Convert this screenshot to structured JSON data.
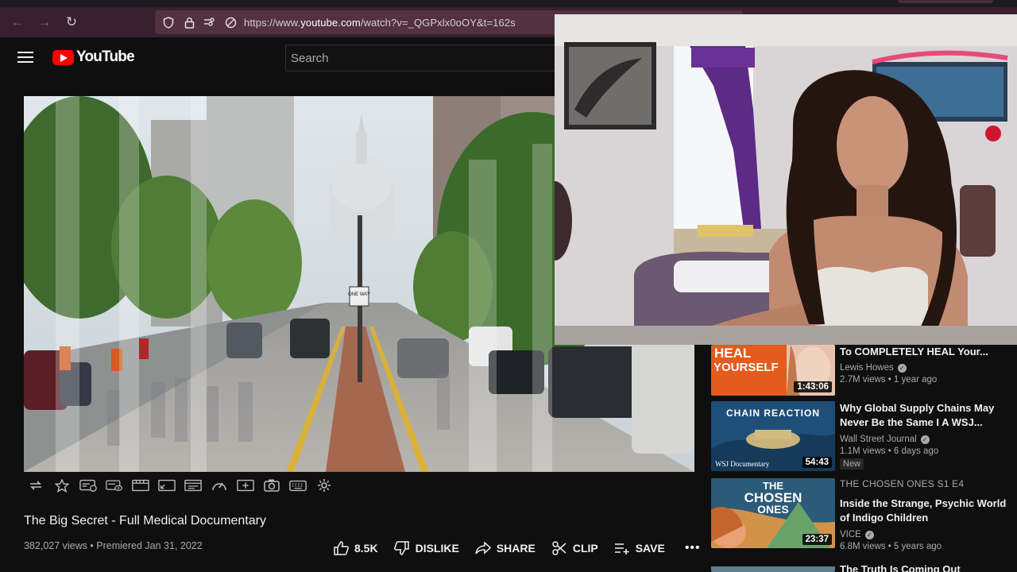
{
  "browser": {
    "url_prefix": "https://www.",
    "url_domain": "youtube.com",
    "url_suffix": "/watch?v=_QGPxlx0oOY&t=162s",
    "back_icon": "←",
    "forward_icon": "→",
    "reload_icon": "↻"
  },
  "header": {
    "logo_text": "YouTube",
    "search_placeholder": "Search"
  },
  "video": {
    "title": "The Big Secret - Full Medical Documentary",
    "views": "382,027 views",
    "separator": "•",
    "premiered": "Premiered Jan 31, 2022",
    "sign_text": "ONE WAY"
  },
  "actions": {
    "like_count": "8.5K",
    "dislike_label": "DISLIKE",
    "share_label": "SHARE",
    "clip_label": "CLIP",
    "save_label": "SAVE",
    "more_label": "•••"
  },
  "recommendations": [
    {
      "thumb_text_1": "HEAL",
      "thumb_text_2": "YOURSELF",
      "duration": "1:43:06",
      "title": "To COMPLETELY HEAL Your...",
      "channel": "Lewis Howes",
      "stats": "2.7M views • 1 year ago"
    },
    {
      "thumb_text_1": "CHAIN REACTION",
      "thumb_text_2": "WSJ Documentary",
      "duration": "54:43",
      "title": "Why Global Supply Chains May Never Be the Same I A WSJ...",
      "channel": "Wall Street Journal",
      "stats": "1.1M views • 6 days ago",
      "badge": "New"
    },
    {
      "thumb_text_1": "THE",
      "thumb_text_2": "CHOSEN",
      "thumb_text_3": "ONES",
      "duration": "23:37",
      "series": "THE CHOSEN ONES  S1 E4",
      "title": "Inside the Strange, Psychic World of Indigo Children",
      "channel": "VICE",
      "stats": "6.8M views • 5 years ago"
    },
    {
      "title": "The Truth Is Coming Out"
    }
  ],
  "colors": {
    "browser_bar": "#3a1f2e",
    "url_bar": "#52323f",
    "yt_red": "#ff0000",
    "page_bg": "#0f0f0f"
  }
}
